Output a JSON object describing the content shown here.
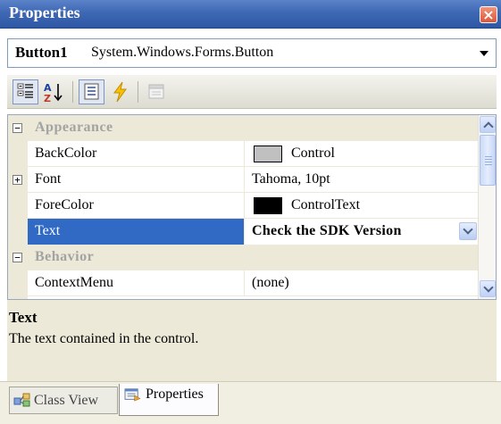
{
  "window": {
    "title": "Properties",
    "close_glyph": "×"
  },
  "selector": {
    "object_name": "Button1",
    "object_type": "System.Windows.Forms.Button"
  },
  "toolbar": {
    "buttons": [
      {
        "name": "categorized-icon",
        "pressed": true
      },
      {
        "name": "alphabetical-icon",
        "pressed": false
      },
      {
        "name": "properties-icon",
        "pressed": true
      },
      {
        "name": "events-icon",
        "pressed": false
      },
      {
        "name": "property-pages-icon",
        "pressed": false,
        "disabled": true
      }
    ]
  },
  "grid": {
    "rows": [
      {
        "kind": "category",
        "expander": "−",
        "label": "Appearance"
      },
      {
        "kind": "property",
        "label": "BackColor",
        "value": "Control",
        "swatch": "#c0c0c0"
      },
      {
        "kind": "property",
        "expander": "+",
        "label": "Font",
        "value": "Tahoma, 10pt"
      },
      {
        "kind": "property",
        "label": "ForeColor",
        "value": "ControlText",
        "swatch": "#000000"
      },
      {
        "kind": "property",
        "label": "Text",
        "value": "Check the SDK Version",
        "selected": true
      },
      {
        "kind": "category",
        "expander": "−",
        "label": "Behavior"
      },
      {
        "kind": "property",
        "label": "ContextMenu",
        "value": "(none)"
      }
    ]
  },
  "description": {
    "title": "Text",
    "text": "The text contained in the control."
  },
  "tabs": [
    {
      "label": "Class View",
      "active": false,
      "icon": "class-view-icon"
    },
    {
      "label": "Properties",
      "active": true,
      "icon": "properties-tab-icon"
    }
  ],
  "colors": {
    "title_bar": "#3f68b4",
    "selection": "#316ac5",
    "panel": "#ece9d8"
  }
}
